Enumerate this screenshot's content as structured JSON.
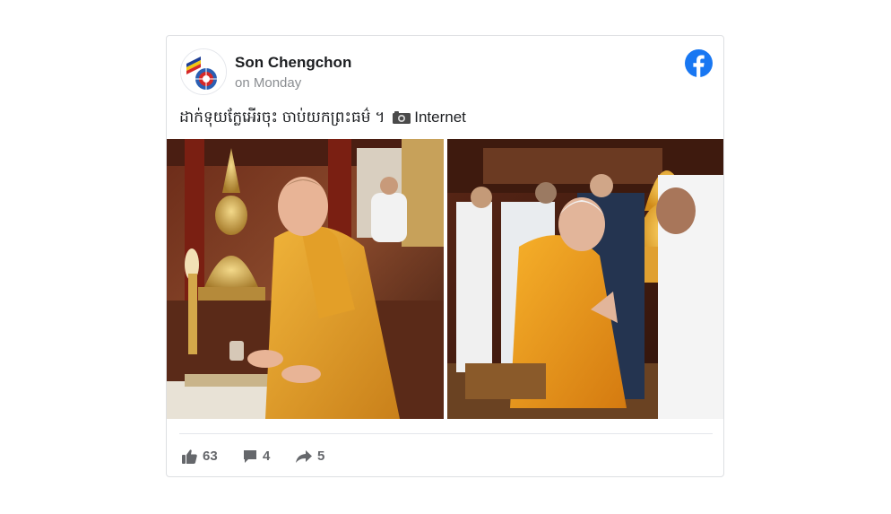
{
  "post": {
    "author": "Son Chengchon",
    "date": "on Monday",
    "caption_text": "ដាក់ទុយក្លែអើរចុះ ចាប់យកព្រះធម៌ ។",
    "caption_source": "Internet",
    "platform_icon": "facebook-icon"
  },
  "images": [
    {
      "icon": "photo",
      "subject": "man in saffron robe seated at altar with golden Buddha statue and candle"
    },
    {
      "icon": "photo",
      "subject": "man in saffron robe kneeling with hands pressed together, golden Buddha in background"
    }
  ],
  "stats": {
    "likes": "63",
    "comments": "4",
    "shares": "5"
  },
  "colors": {
    "facebook_blue": "#1877f2",
    "robe_saffron": "#e3a21a",
    "text_primary": "#1c1e21",
    "text_secondary": "#8a8d91"
  }
}
